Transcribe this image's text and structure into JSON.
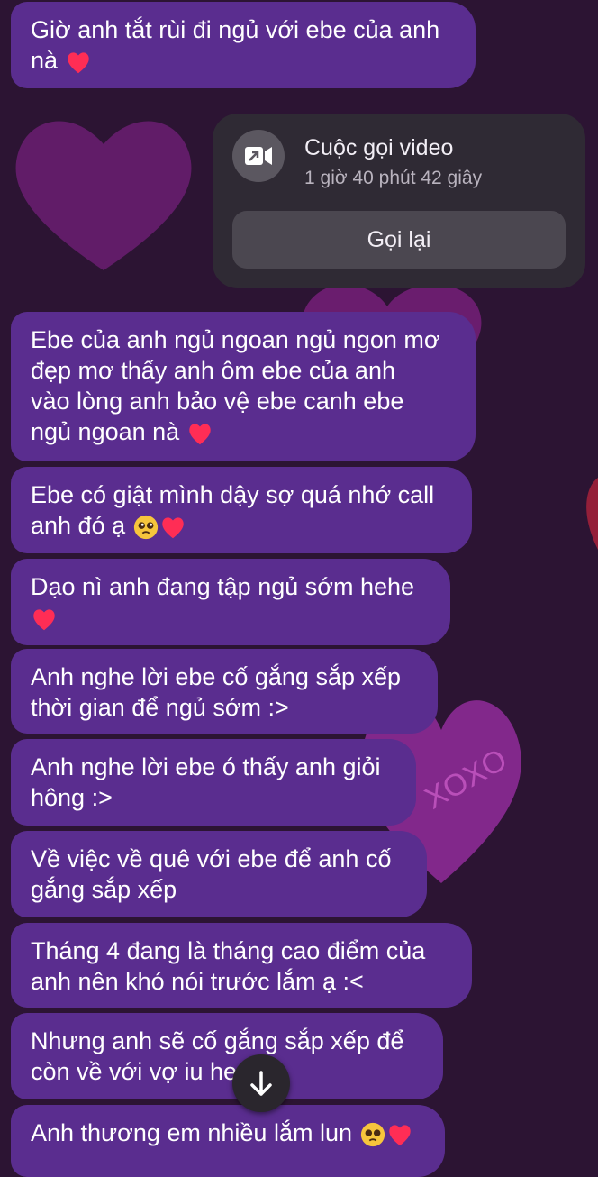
{
  "messages": [
    {
      "text": "Giờ anh tắt rùi đi ngủ với ebe của anh\nnà",
      "emoji": [
        "red-heart-icon"
      ]
    },
    {
      "text": "Ebe của anh ngủ ngoan ngủ ngon mơ\nđẹp mơ thấy anh ôm ebe của anh\nvào lòng anh bảo vệ ebe canh ebe\nngủ ngoan nà",
      "emoji": [
        "red-heart-icon"
      ]
    },
    {
      "text": "Ebe có giật mình dậy sợ quá nhớ call\nanh đó ạ",
      "emoji": [
        "pleading-face-icon",
        "red-heart-icon"
      ]
    },
    {
      "text": "Dạo nì anh đang tập ngủ sớm hehe\n",
      "emoji": [
        "red-heart-icon"
      ]
    },
    {
      "text": "Anh nghe lời ebe cố gắng sắp xếp\nthời gian để ngủ sớm :>"
    },
    {
      "text": "Anh nghe lời ebe ó thấy anh giỏi\nhông :>"
    },
    {
      "text": "Về việc về quê với ebe để anh cố\ngắng sắp xếp"
    },
    {
      "text": "Tháng 4 đang là tháng cao điểm của\nanh nên khó nói trước lắm ạ :<"
    },
    {
      "text": "Nhưng anh sẽ cố gắng sắp xếp để\ncòn về với vợ iu he",
      "emoji": [
        "red-heart-icon"
      ]
    },
    {
      "text": "Anh thương em nhiều lắm lun",
      "emoji": [
        "pleading-face-icon",
        "red-heart-icon"
      ]
    }
  ],
  "call": {
    "title": "Cuộc gọi video",
    "duration": "1 giờ 40 phút 42 giây",
    "callback_label": "Gọi lại",
    "icon": "video-call-icon"
  },
  "background_text": "XOXO",
  "scroll_icon": "arrow-down-icon",
  "colors": {
    "background": "#2c1433",
    "bubble": "#5a2d8f",
    "call_card": "#2f2a34",
    "heart": "#ff2d55"
  }
}
